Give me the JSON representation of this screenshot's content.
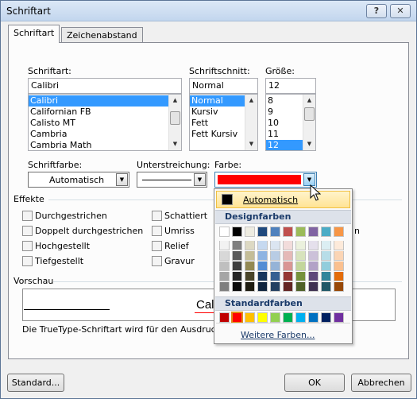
{
  "window": {
    "title": "Schriftart",
    "help_label": "?",
    "close_label": "✕"
  },
  "tabs": [
    {
      "label": "Schriftart",
      "mnemonic": "r"
    },
    {
      "label": "Zeichenabstand",
      "mnemonic": "Z"
    }
  ],
  "font": {
    "label": "Schriftart:",
    "value": "Calibri",
    "items": [
      "Calibri",
      "Californian FB",
      "Calisto MT",
      "Cambria",
      "Cambria Math"
    ],
    "selected_index": 0
  },
  "style": {
    "label": "Schriftschnitt:",
    "value": "Normal",
    "items": [
      "Normal",
      "Kursiv",
      "Fett",
      "Fett Kursiv"
    ],
    "selected_index": 0
  },
  "size": {
    "label": "Größe:",
    "value": "12",
    "items": [
      "8",
      "9",
      "10",
      "11",
      "12"
    ],
    "selected_index": 4
  },
  "font_color": {
    "label": "Schriftfarbe:",
    "value": "Automatisch"
  },
  "underline": {
    "label": "Unterstreichung:"
  },
  "underline_color": {
    "label": "Farbe:",
    "value_color": "#ff0000"
  },
  "effects": {
    "header": "Effekte",
    "left": [
      "Durchgestrichen",
      "Doppelt durchgestrichen",
      "Hochgestellt",
      "Tiefgestellt"
    ],
    "right": [
      "Schattiert",
      "Umriss",
      "Relief",
      "Gravur"
    ],
    "partial_right_text": "n"
  },
  "preview": {
    "header": "Vorschau",
    "sample_text": "Cali",
    "note": "Die TrueType-Schriftart wird für den Ausdruck und"
  },
  "color_popup": {
    "auto_label": "Automatisch",
    "design_header": "Designfarben",
    "standard_header": "Standardfarben",
    "more_label": "Weitere Farben...",
    "theme_colors": [
      "#ffffff",
      "#000000",
      "#eeece1",
      "#1f497d",
      "#4f81bd",
      "#c0504d",
      "#9bbb59",
      "#8064a2",
      "#4bacc6",
      "#f79646"
    ],
    "tint_rows": [
      [
        "#f2f2f2",
        "#7f7f7f",
        "#ddd9c3",
        "#c6d9f0",
        "#dbe5f1",
        "#f2dcdb",
        "#ebf1dd",
        "#e5e0ec",
        "#dbeef3",
        "#fdeada"
      ],
      [
        "#d8d8d8",
        "#595959",
        "#c4bd97",
        "#8db3e2",
        "#b8cce4",
        "#e5b9b7",
        "#d7e3bc",
        "#ccc1d9",
        "#b7dde8",
        "#fbd5b5"
      ],
      [
        "#bfbfbf",
        "#3f3f3f",
        "#938953",
        "#548dd4",
        "#95b3d7",
        "#d99694",
        "#c3d69b",
        "#b2a2c7",
        "#92cddc",
        "#fac08f"
      ],
      [
        "#a5a5a5",
        "#262626",
        "#494429",
        "#17365d",
        "#366092",
        "#953734",
        "#76923c",
        "#5f497a",
        "#31859b",
        "#e36c09"
      ],
      [
        "#7f7f7f",
        "#0c0c0c",
        "#1d1b10",
        "#0f243e",
        "#244061",
        "#632423",
        "#4f6128",
        "#3f3151",
        "#205867",
        "#974806"
      ]
    ],
    "standard_colors": [
      "#c00000",
      "#ff0000",
      "#ffc000",
      "#ffff00",
      "#92d050",
      "#00b050",
      "#00b0f0",
      "#0070c0",
      "#002060",
      "#7030a0"
    ],
    "selected_standard_index": 1
  },
  "buttons": {
    "standard": "Standard...",
    "ok": "OK",
    "cancel": "Abbrechen"
  }
}
